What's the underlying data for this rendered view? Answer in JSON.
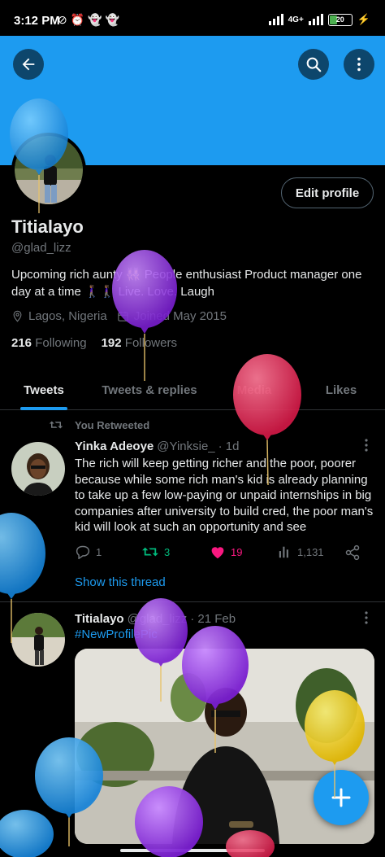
{
  "status_bar": {
    "time": "3:12 PM",
    "left_icons": [
      "mute-icon",
      "alarm-icon",
      "snapchat-icon",
      "snapchat-icon"
    ],
    "network": "4G+",
    "battery": "20"
  },
  "header": {
    "back_icon": "arrow-left-icon",
    "search_icon": "search-icon",
    "more_icon": "more-vertical-icon",
    "banner_color": "#1d9bf0"
  },
  "profile": {
    "edit_button": "Edit profile",
    "name": "Titialayo",
    "handle": "@glad_lizz",
    "bio": "Upcoming rich aunty 👯‍♀️ People enthusiast  Product manager one day at a time 🚶🏾‍♀️🚶🏾‍♀️ Live. Love. Laugh",
    "location": "Lagos, Nigeria",
    "joined": "Joined May 2015",
    "following_count": "216",
    "following_label": "Following",
    "followers_count": "192",
    "followers_label": "Followers"
  },
  "tabs": [
    {
      "label": "Tweets",
      "active": true
    },
    {
      "label": "Tweets & replies",
      "active": false
    },
    {
      "label": "Media",
      "active": false
    },
    {
      "label": "Likes",
      "active": false
    }
  ],
  "tweets": [
    {
      "retweet_label": "You Retweeted",
      "author": "Yinka Adeoye",
      "handle": "@Yinksie_",
      "time": "· 1d",
      "text": "The rich will keep getting richer and the poor, poorer because while some rich man's kid is already planning to take up a few low-paying or unpaid internships in big companies after university to build cred, the poor man's kid will look at such an opportunity and see",
      "replies": "1",
      "retweets": "3",
      "likes": "19",
      "views": "1,131",
      "show_thread": "Show this thread"
    },
    {
      "author": "Titialayo",
      "handle": "@glad_lizz",
      "time": "· 21 Feb",
      "text": "#NewProfilePic"
    }
  ],
  "fab": {
    "icon": "plus-icon",
    "label": "+"
  },
  "colors": {
    "accent": "#1d9bf0",
    "retweet": "#00ba7c",
    "like": "#f91880",
    "muted": "#71767b",
    "text": "#e7e9ea"
  }
}
